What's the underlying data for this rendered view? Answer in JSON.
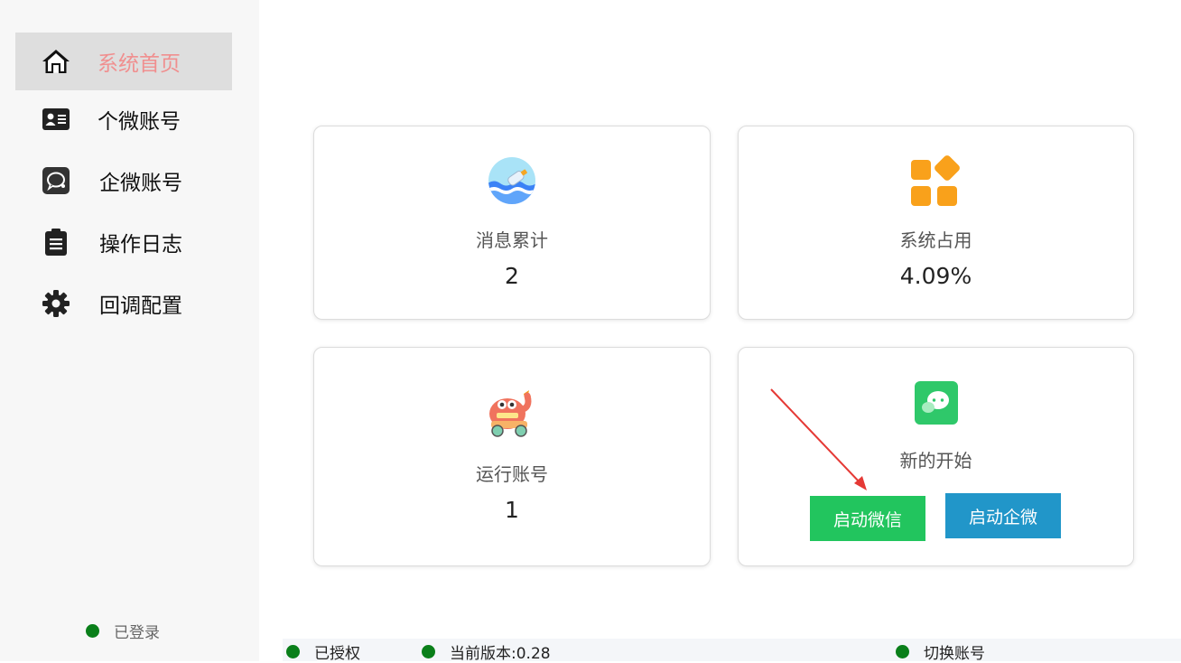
{
  "sidebar": {
    "items": [
      {
        "label": "系统首页",
        "icon": "home-icon",
        "active": true
      },
      {
        "label": "个微账号",
        "icon": "id-card-icon",
        "active": false
      },
      {
        "label": "企微账号",
        "icon": "chat-bubble-icon",
        "active": false
      },
      {
        "label": "操作日志",
        "icon": "clipboard-icon",
        "active": false
      },
      {
        "label": "回调配置",
        "icon": "gear-icon",
        "active": false
      }
    ],
    "login_status": "已登录"
  },
  "cards": {
    "messages": {
      "label": "消息累计",
      "value": "2",
      "icon": "message-bottle-icon"
    },
    "system": {
      "label": "系统占用",
      "value": "4.09%",
      "icon": "apps-icon"
    },
    "running": {
      "label": "运行账号",
      "value": "1",
      "icon": "monster-cart-icon"
    },
    "start": {
      "label": "新的开始",
      "icon": "wechat-icon",
      "wechat_button": "启动微信",
      "wework_button": "启动企微"
    }
  },
  "status_bar": {
    "authorized": "已授权",
    "version": "当前版本:0.28",
    "switch_account": "切换账号"
  },
  "colors": {
    "accent_active_text": "#f08f8f",
    "status_dot": "#0a7f1a",
    "wechat_button": "#22c55e",
    "wework_button": "#2196c9"
  }
}
